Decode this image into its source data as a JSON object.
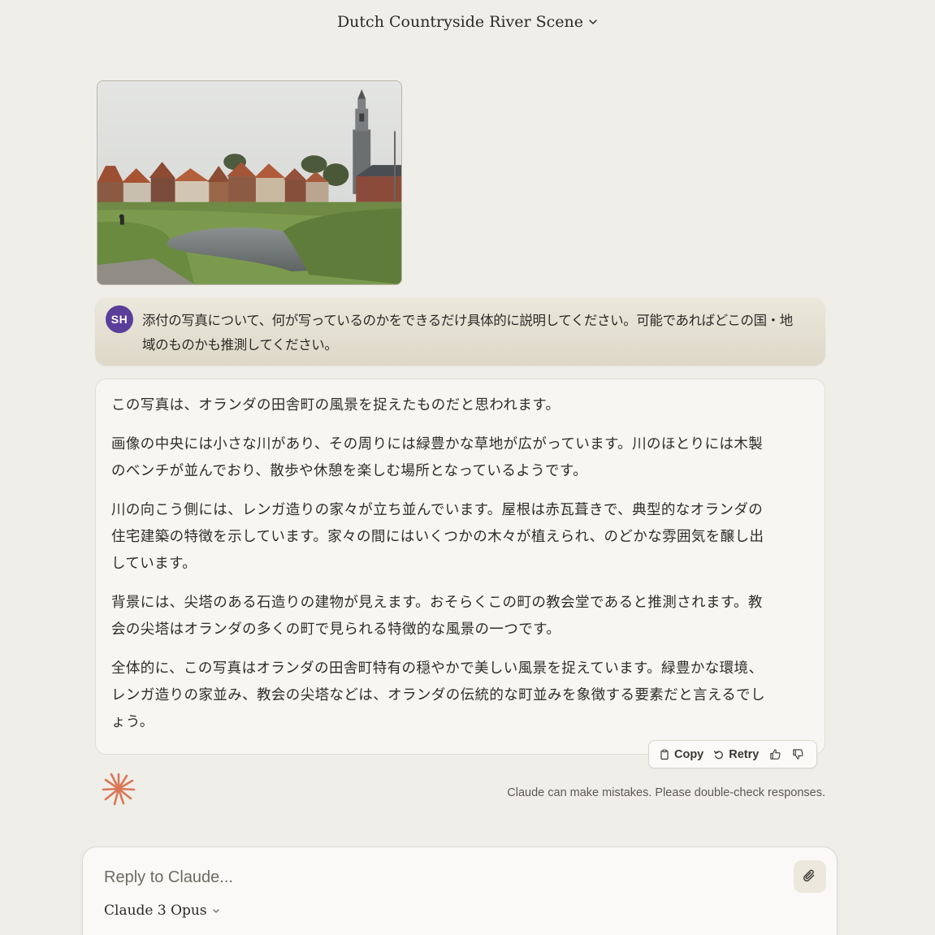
{
  "header": {
    "title": "Dutch Countryside River Scene"
  },
  "user_message": {
    "avatar_initials": "SH",
    "text": "添付の写真について、何が写っているのかをできるだけ具体的に説明してください。可能であればどこの国・地域のものかも推測してください。"
  },
  "assistant_message": {
    "paragraphs": [
      "この写真は、オランダの田舎町の風景を捉えたものだと思われます。",
      "画像の中央には小さな川があり、その周りには緑豊かな草地が広がっています。川のほとりには木製のベンチが並んでおり、散歩や休憩を楽しむ場所となっているようです。",
      "川の向こう側には、レンガ造りの家々が立ち並んでいます。屋根は赤瓦葺きで、典型的なオランダの住宅建築の特徴を示しています。家々の間にはいくつかの木々が植えられ、のどかな雰囲気を醸し出しています。",
      "背景には、尖塔のある石造りの建物が見えます。おそらくこの町の教会堂であると推測されます。教会の尖塔はオランダの多くの町で見られる特徴的な風景の一つです。",
      "全体的に、この写真はオランダの田舎町特有の穏やかで美しい風景を捉えています。緑豊かな環境、レンガ造りの家並み、教会の尖塔などは、オランダの伝統的な町並みを象徴する要素だと言えるでしょう。"
    ]
  },
  "actions": {
    "copy_label": "Copy",
    "retry_label": "Retry"
  },
  "disclaimer": "Claude can make mistakes. Please double-check responses.",
  "composer": {
    "placeholder": "Reply to Claude...",
    "model_label": "Claude 3 Opus"
  },
  "colors": {
    "accent": "#d97757",
    "avatar": "#5a3e9a",
    "background": "#f0eee8"
  }
}
